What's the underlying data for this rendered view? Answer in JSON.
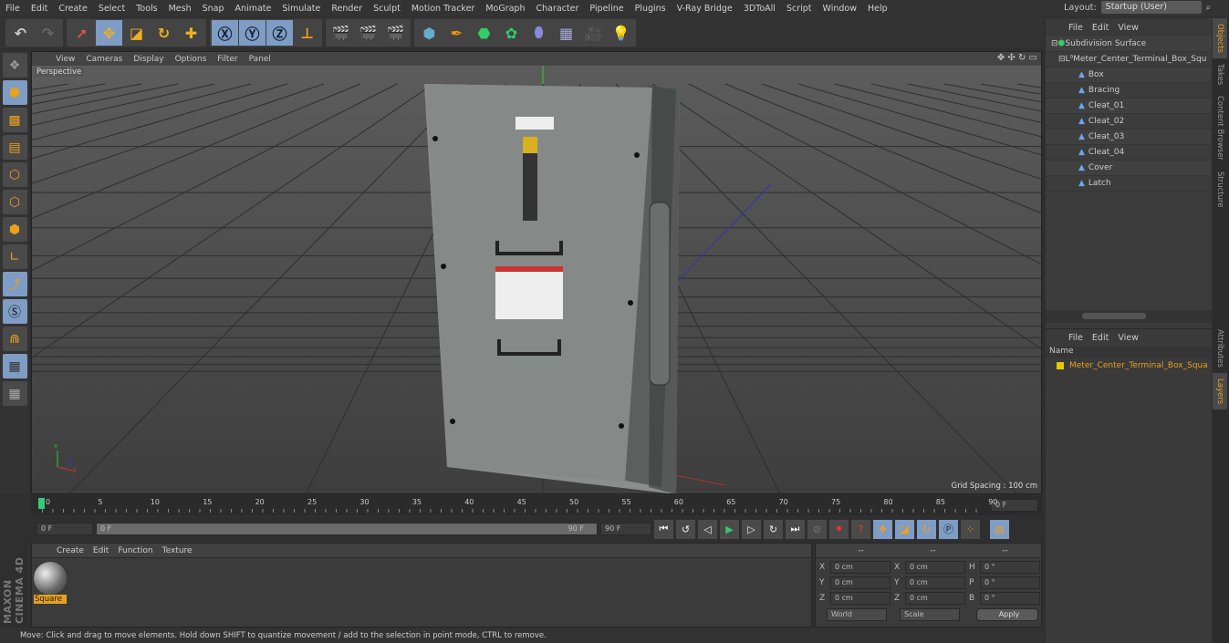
{
  "menu": [
    "File",
    "Edit",
    "Create",
    "Select",
    "Tools",
    "Mesh",
    "Snap",
    "Animate",
    "Simulate",
    "Render",
    "Sculpt",
    "Motion Tracker",
    "MoGraph",
    "Character",
    "Pipeline",
    "Plugins",
    "V-Ray Bridge",
    "3DToAll",
    "Script",
    "Window",
    "Help"
  ],
  "layout": {
    "label": "Layout:",
    "value": "Startup (User)"
  },
  "viewport": {
    "menu": [
      "View",
      "Cameras",
      "Display",
      "Options",
      "Filter",
      "Panel"
    ],
    "camera": "Perspective",
    "grid_spacing": "Grid Spacing : 100 cm"
  },
  "timeline": {
    "ticks": [
      "0",
      "5",
      "10",
      "15",
      "20",
      "25",
      "30",
      "35",
      "40",
      "45",
      "50",
      "55",
      "60",
      "65",
      "70",
      "75",
      "80",
      "85",
      "90"
    ],
    "current": "0 F",
    "start": "0 F",
    "range_start": "0 F",
    "range_end": "90 F",
    "end": "90 F"
  },
  "material_manager": {
    "menu": [
      "Create",
      "Edit",
      "Function",
      "Texture"
    ],
    "materials": [
      {
        "name": "Square"
      }
    ]
  },
  "coordinates": {
    "headers": [
      "--",
      "--",
      "--"
    ],
    "rows": [
      [
        "X",
        "0 cm",
        "X",
        "0 cm",
        "H",
        "0 °"
      ],
      [
        "Y",
        "0 cm",
        "Y",
        "0 cm",
        "P",
        "0 °"
      ],
      [
        "Z",
        "0 cm",
        "Z",
        "0 cm",
        "B",
        "0 °"
      ]
    ],
    "world": "World",
    "scale": "Scale",
    "apply": "Apply"
  },
  "status": "Move: Click and drag to move elements. Hold down SHIFT to quantize movement / add to the selection in point mode, CTRL to remove.",
  "objects": {
    "menu": [
      "File",
      "Edit",
      "View"
    ],
    "root": "Subdivision Surface",
    "group": "Meter_Center_Terminal_Box_Squ",
    "children": [
      "Box",
      "Bracing",
      "Cleat_01",
      "Cleat_02",
      "Cleat_03",
      "Cleat_04",
      "Cover",
      "Latch"
    ]
  },
  "layers": {
    "menu": [
      "File",
      "Edit",
      "View"
    ],
    "header": "Name",
    "items": [
      "Meter_Center_Terminal_Box_Squa"
    ]
  },
  "side_tabs_top": [
    "Objects",
    "Takes",
    "Content Browser",
    "Structure"
  ],
  "side_tabs_bottom": [
    "Attributes",
    "Layers"
  ],
  "brand": "MAXON CINEMA 4D",
  "colors": {
    "accent": "#e8a020",
    "selected": "#7e9cc4",
    "layer": "#e8c800"
  }
}
